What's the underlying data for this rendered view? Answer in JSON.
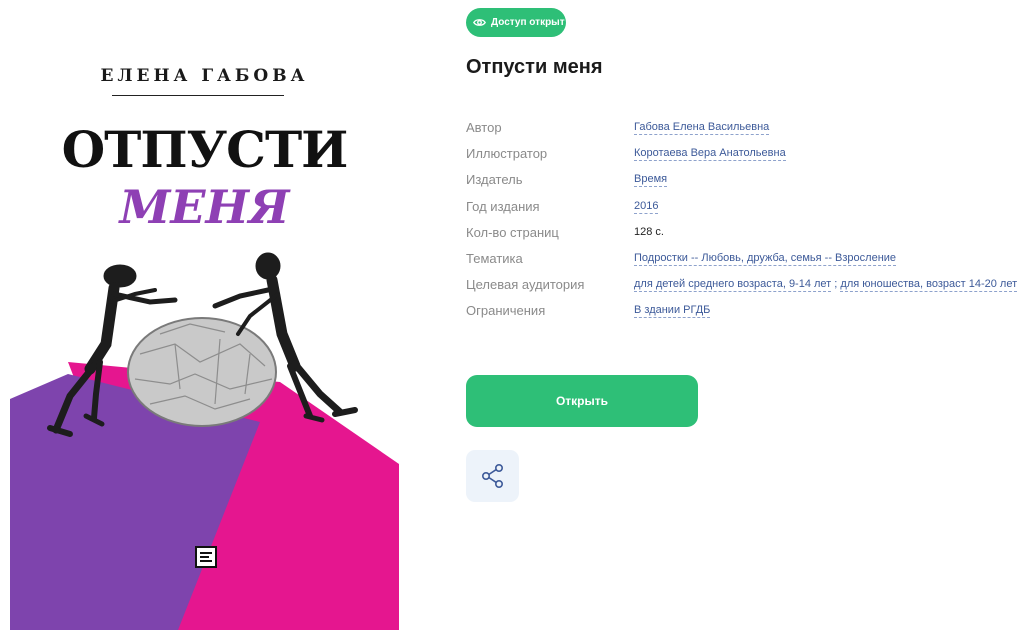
{
  "badge": {
    "label": "Доступ открыт",
    "icon": "eye-icon"
  },
  "book": {
    "title": "Отпусти меня"
  },
  "cover": {
    "author": "ЕЛЕНА ГАБОВА",
    "title_line1": "ОТПУСТИ",
    "title_line2": "МЕНЯ",
    "colors": {
      "magenta": "#e5168f",
      "purple": "#7e44ad",
      "title_purple": "#8e40b4"
    }
  },
  "meta": [
    {
      "label": "Автор",
      "values": [
        "Габова Елена Васильевна"
      ]
    },
    {
      "label": "Иллюстратор",
      "values": [
        "Коротаева Вера Анатольевна"
      ]
    },
    {
      "label": "Издатель",
      "values": [
        "Время"
      ]
    },
    {
      "label": "Год издания",
      "values": [
        "2016"
      ]
    },
    {
      "label": "Кол-во страниц",
      "values": [
        "128 с."
      ]
    },
    {
      "label": "Тематика",
      "values": [
        "Подростки -- Любовь, дружба, семья -- Взросление"
      ]
    },
    {
      "label": "Целевая аудитория",
      "values": [
        "для детей среднего возраста, 9-14 лет",
        "для юношества, возраст 14-20 лет"
      ],
      "separator": " ; "
    },
    {
      "label": "Ограничения",
      "values": [
        "В здании РГДБ"
      ]
    }
  ],
  "actions": {
    "open_label": "Открыть",
    "share_icon": "share-icon"
  },
  "colors": {
    "accent_green": "#2ebf77",
    "link_blue": "#3d5a99",
    "share_bg": "#edf3fa"
  }
}
